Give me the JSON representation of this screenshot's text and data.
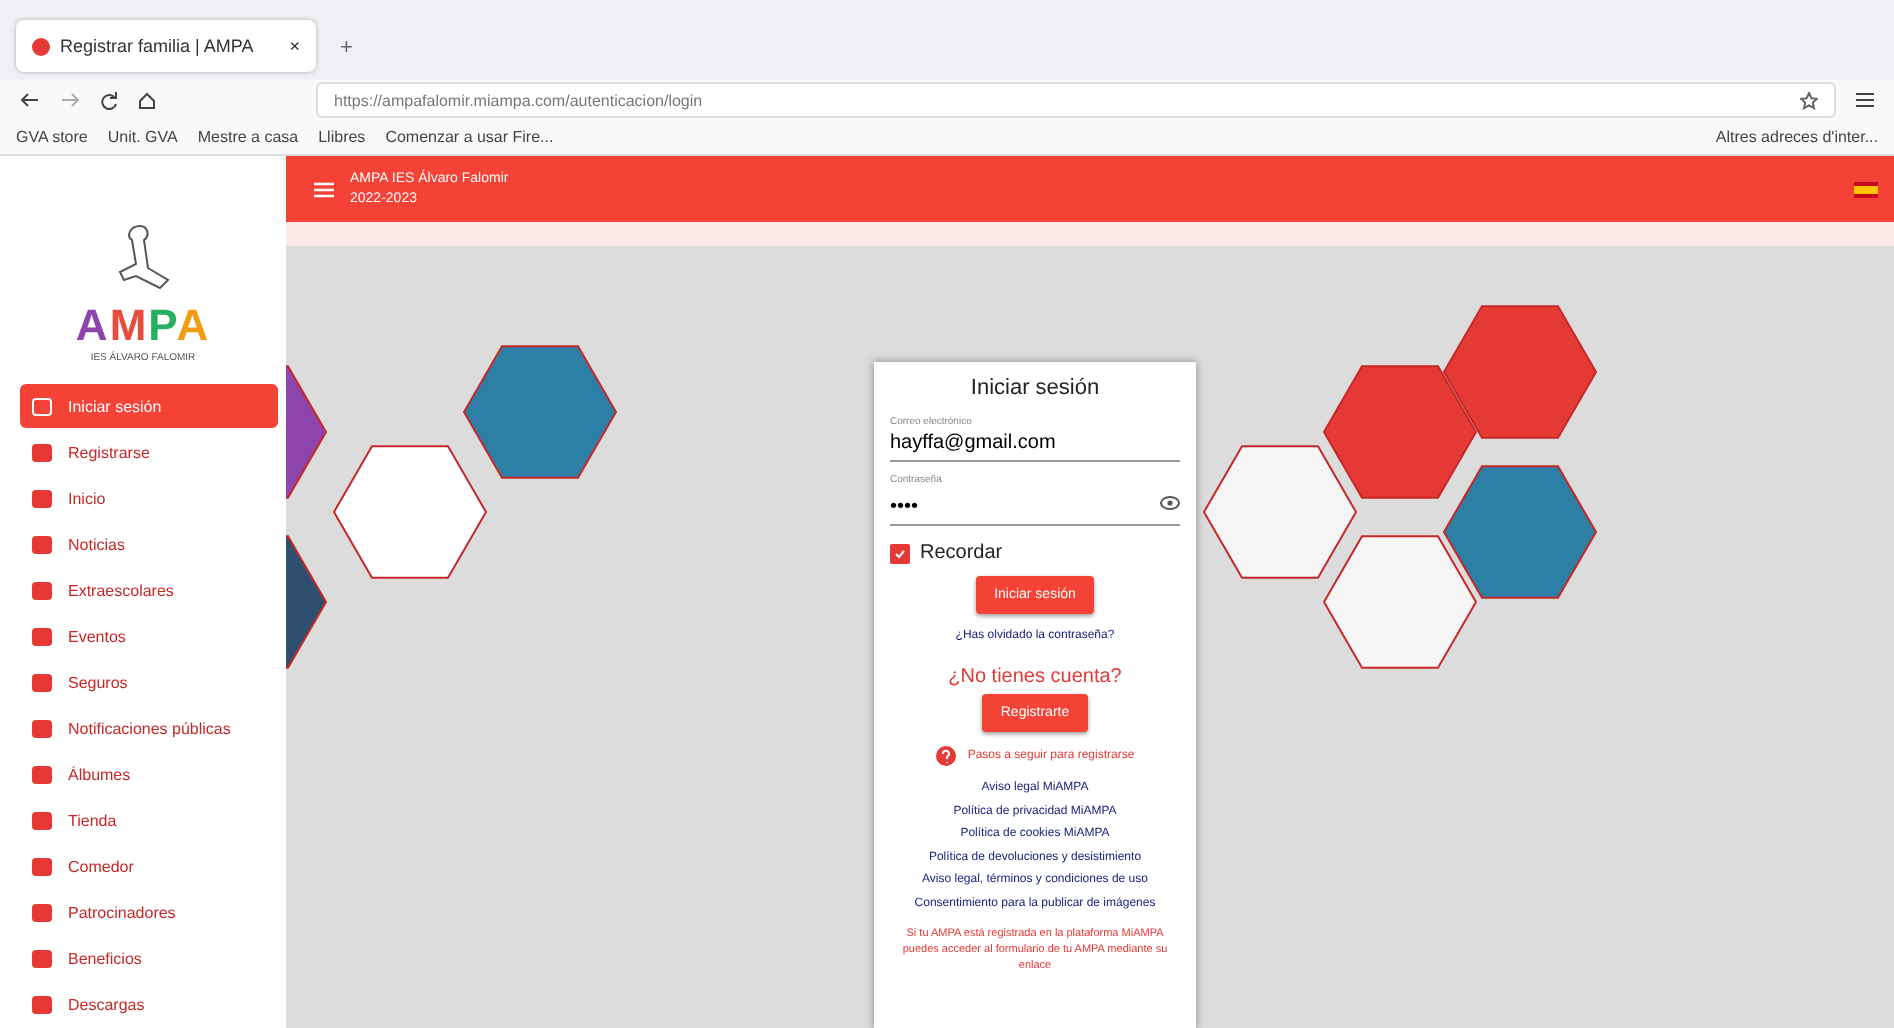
{
  "browser": {
    "tabs": [
      {
        "title": "Registrar familia | AMPA",
        "selected": true
      }
    ],
    "new_tab": "+",
    "close": "×",
    "url": "https://ampafalomir.miampa.com/autenticacion/login",
    "bookmarks": [
      "GVA store",
      "Unit. GVA",
      "Mestre a casa",
      "Llibres",
      "Comenzar a usar Fire..."
    ],
    "other_bookmarks": "Altres adreces d'inter..."
  },
  "logo": {
    "wordmark": "AMPA",
    "subtitle": "IES ÁLVARO FALOMIR"
  },
  "header": {
    "title": "AMPA IES Álvaro Falomir",
    "subtitle": "2022-2023"
  },
  "sidebar": {
    "items": [
      {
        "label": "Iniciar sesión",
        "selected": true
      },
      {
        "label": "Registrarse",
        "selected": false
      },
      {
        "label": "Inicio",
        "selected": false
      },
      {
        "label": "Noticias",
        "selected": false
      },
      {
        "label": "Extraescolares",
        "selected": false
      },
      {
        "label": "Eventos",
        "selected": false
      },
      {
        "label": "Seguros",
        "selected": false
      },
      {
        "label": "Notificaciones públicas",
        "selected": false
      },
      {
        "label": "Álbumes",
        "selected": false
      },
      {
        "label": "Tienda",
        "selected": false
      },
      {
        "label": "Comedor",
        "selected": false
      },
      {
        "label": "Patrocinadores",
        "selected": false
      },
      {
        "label": "Beneficios",
        "selected": false
      },
      {
        "label": "Descargas",
        "selected": false
      }
    ]
  },
  "login": {
    "title": "Iniciar sesión",
    "email": {
      "label": "Correo electrónico",
      "value": "hayffa@gmail.com"
    },
    "password": {
      "label": "Contraseña",
      "value": "••••"
    },
    "remember": {
      "label": "Recordar",
      "checked": true
    },
    "submit": "Iniciar sesión",
    "forgot": "¿Has olvidado la contraseña?",
    "no_account": "¿No tienes cuenta?",
    "register": "Registrarte",
    "help": "Pasos a seguir para registrarse",
    "links": [
      "Aviso legal MiAMPA",
      "Política de privacidad MiAMPA",
      "Política de cookies MiAMPA",
      "Política de devoluciones y desistimiento",
      "Aviso legal, términos y condiciones de uso",
      "Consentimiento para la publicar de imágenes"
    ],
    "note": "Si tu AMPA está registrada en la plataforma MiAMPA puedes acceder al formulario de tu AMPA mediante su enlace"
  }
}
